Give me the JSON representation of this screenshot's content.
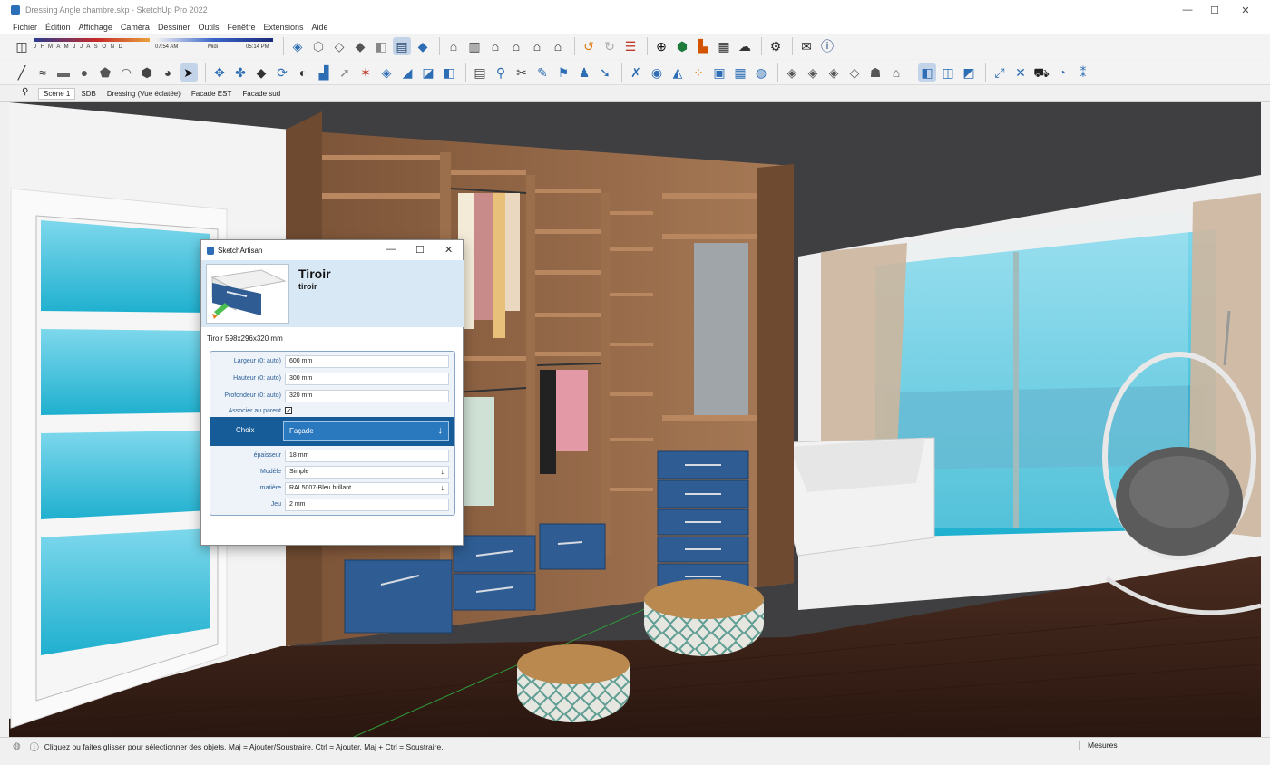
{
  "window": {
    "title": "Dressing Angle chambre.skp - SketchUp Pro 2022",
    "minimize": "—",
    "maximize": "☐",
    "close": "✕"
  },
  "menu": [
    "Fichier",
    "Édition",
    "Affichage",
    "Caméra",
    "Dessiner",
    "Outils",
    "Fenêtre",
    "Extensions",
    "Aide"
  ],
  "shadows": {
    "months": "J F M A M J J A S O N D",
    "time_start": "07:54 AM",
    "time_mid": "Midi",
    "time_end": "05:14 PM"
  },
  "scenes": [
    "Scène 1",
    "SDB",
    "Dressing (Vue éclatée)",
    "Facade EST",
    "Facade sud"
  ],
  "dialog": {
    "title": "SketchArtisan",
    "heading": "Tiroir",
    "subheading": "tiroir",
    "dims": "Tiroir 598x296x320 mm",
    "fields": {
      "largeur_label": "Largeur (0: auto)",
      "largeur_value": "600 mm",
      "hauteur_label": "Hauteur (0: auto)",
      "hauteur_value": "300 mm",
      "profondeur_label": "Profondeur (0: auto)",
      "profondeur_value": "320 mm",
      "associer_label": "Associer au parent",
      "associer_checked": "✓",
      "choix_label": "Choix",
      "choix_value": "Façade",
      "epaisseur_label": "épaisseur",
      "epaisseur_value": "18 mm",
      "modele_label": "Modèle",
      "modele_value": "Simple",
      "matiere_label": "matière",
      "matiere_value": "RAL5007-Bleu brillant",
      "jeu_label": "Jeu",
      "jeu_value": "2 mm"
    }
  },
  "status": {
    "text": "Cliquez ou faites glisser pour sélectionner des objets. Maj = Ajouter/Soustraire. Ctrl = Ajouter. Maj + Ctrl = Soustraire.",
    "measures_label": "Mesures"
  },
  "colors": {
    "accent": "#165c99",
    "drawer_blue": "#2f5d93",
    "wood": "#8a5e3e",
    "floor": "#3a2218"
  }
}
